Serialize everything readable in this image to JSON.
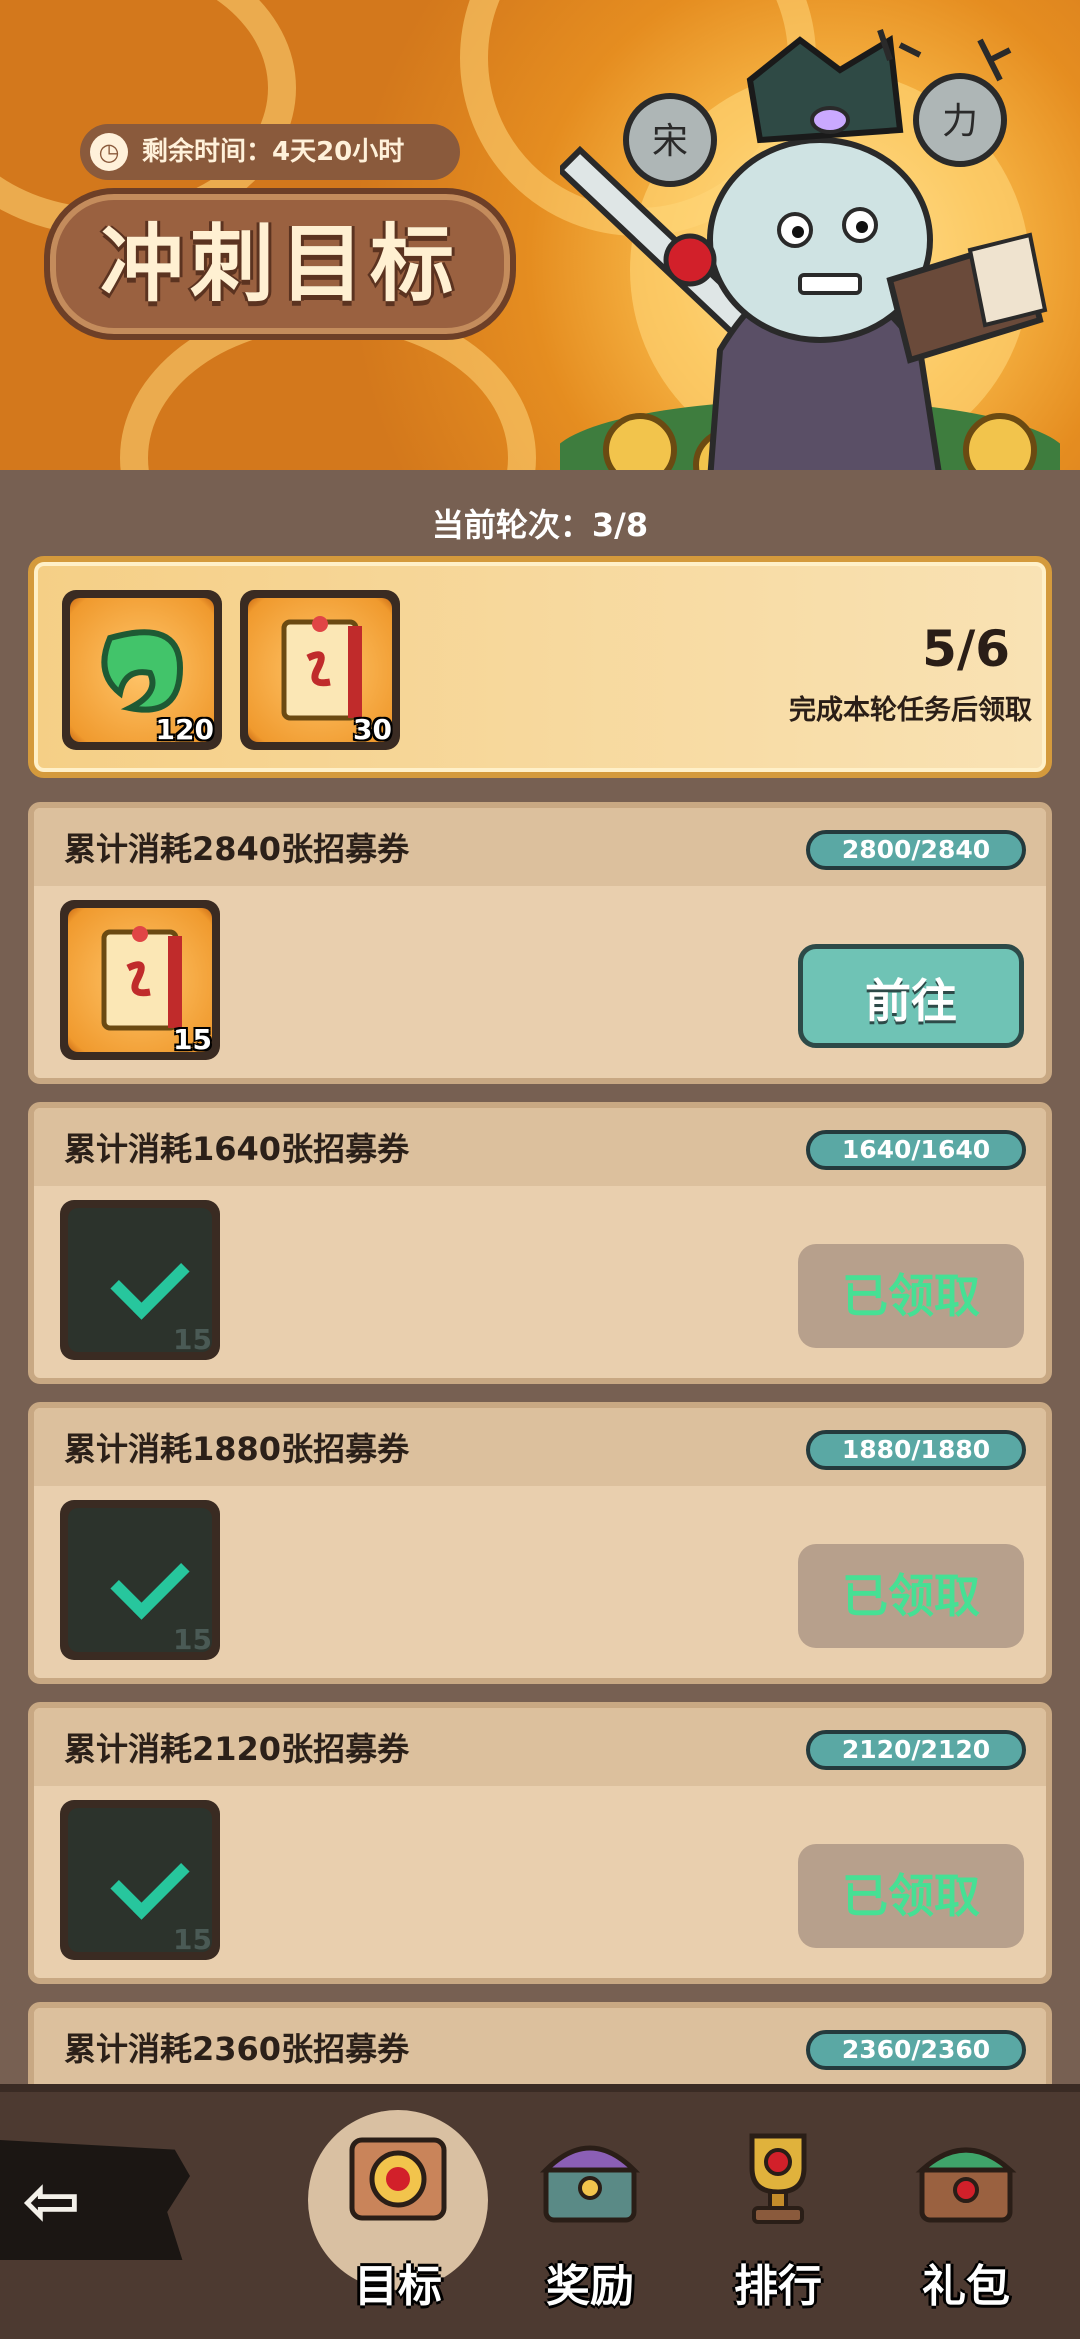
{
  "header": {
    "timer_label": "剩余时间：4天20小时",
    "title": "冲刺目标"
  },
  "round": {
    "label": "当前轮次：3/8"
  },
  "summary": {
    "rewards": [
      {
        "icon": "jade-icon",
        "qty": "120"
      },
      {
        "icon": "scroll-icon",
        "qty": "30"
      }
    ],
    "progress": "5/6",
    "note": "完成本轮任务后领取"
  },
  "tasks": [
    {
      "label": "累计消耗2840张招募券",
      "progress": "2800/2840",
      "reward_qty": "15",
      "button": "前往",
      "state": "go"
    },
    {
      "label": "累计消耗1640张招募券",
      "progress": "1640/1640",
      "reward_qty": "15",
      "button": "已领取",
      "state": "claimed"
    },
    {
      "label": "累计消耗1880张招募券",
      "progress": "1880/1880",
      "reward_qty": "15",
      "button": "已领取",
      "state": "claimed"
    },
    {
      "label": "累计消耗2120张招募券",
      "progress": "2120/2120",
      "reward_qty": "15",
      "button": "已领取",
      "state": "claimed"
    },
    {
      "label": "累计消耗2360张招募券",
      "progress": "2360/2360",
      "reward_qty": "",
      "button": "",
      "state": "partial"
    }
  ],
  "nav": {
    "back_icon": "back-arrow-icon",
    "tabs": [
      {
        "label": "目标",
        "icon": "target-icon",
        "active": true
      },
      {
        "label": "奖励",
        "icon": "chest-icon",
        "active": false
      },
      {
        "label": "排行",
        "icon": "trophy-icon",
        "active": false
      },
      {
        "label": "礼包",
        "icon": "gift-chest-icon",
        "active": false
      }
    ]
  },
  "colors": {
    "accent_teal": "#6fc3b5",
    "claimed_green": "#46e094",
    "panel_brown": "#776052",
    "card_bg": "#e9cfae"
  }
}
